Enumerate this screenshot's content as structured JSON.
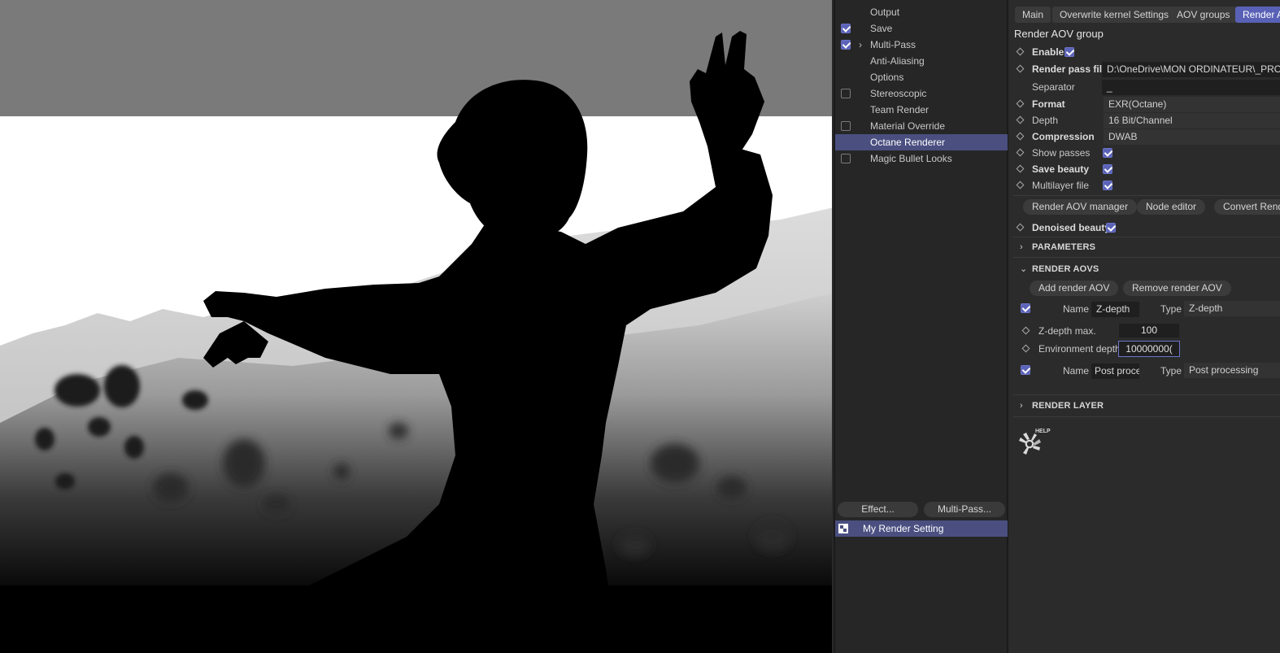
{
  "settings_list": {
    "items": [
      {
        "label": "Output",
        "checkbox": "none",
        "selected": false
      },
      {
        "label": "Save",
        "checkbox": "on",
        "selected": false
      },
      {
        "label": "Multi-Pass",
        "checkbox": "on",
        "expandable": true,
        "selected": false
      },
      {
        "label": "Anti-Aliasing",
        "checkbox": "none",
        "selected": false
      },
      {
        "label": "Options",
        "checkbox": "none",
        "selected": false
      },
      {
        "label": "Stereoscopic",
        "checkbox": "off",
        "selected": false
      },
      {
        "label": "Team Render",
        "checkbox": "none",
        "selected": false
      },
      {
        "label": "Material Override",
        "checkbox": "off",
        "selected": false
      },
      {
        "label": "Octane Renderer",
        "checkbox": "none",
        "selected": true
      },
      {
        "label": "Magic Bullet Looks",
        "checkbox": "off",
        "selected": false
      }
    ],
    "effect_button": "Effect...",
    "multipass_button": "Multi-Pass...",
    "render_setting": "My Render Setting"
  },
  "attr_panel": {
    "tabs": [
      "Main",
      "Overwrite kernel Settings",
      "AOV groups",
      "Render AOV group"
    ],
    "active_tab": 3,
    "title": "Render AOV group",
    "enable_label": "Enable",
    "render_pass_file_label": "Render pass file",
    "render_pass_file_value": "D:\\OneDrive\\MON ORDINATEUR\\_PROJETS",
    "separator_label": "Separator",
    "separator_value": "_",
    "format_label": "Format",
    "format_value": "EXR(Octane)",
    "depth_label": "Depth",
    "depth_value": "16 Bit/Channel",
    "compression_label": "Compression",
    "compression_value": "DWAB",
    "show_passes_label": "Show passes",
    "save_beauty_label": "Save beauty",
    "multilayer_label": "Multilayer file",
    "aov_manager_button": "Render AOV manager",
    "node_editor_button": "Node editor",
    "convert_button": "Convert Render",
    "denoised_beauty_label": "Denoised beauty",
    "parameters_header": "PARAMETERS",
    "render_aovs_header": "RENDER AOVS",
    "add_aov_button": "Add render AOV",
    "remove_aov_button": "Remove render AOV",
    "aov1": {
      "name_label": "Name",
      "name_value": "Z-depth",
      "type_label": "Type",
      "type_value": "Z-depth"
    },
    "zdepth_max_label": "Z-depth max.",
    "zdepth_max_value": "100",
    "env_depth_label": "Environment depth",
    "env_depth_value": "10000000(",
    "aov2": {
      "name_label": "Name",
      "name_value": "Post proce",
      "type_label": "Type",
      "type_value": "Post processing"
    },
    "render_layer_header": "RENDER LAYER",
    "help_label": "HELP"
  },
  "colors": {
    "accent": "#5961b6",
    "selected_row": "#4a4f80",
    "panel_bg": "#2b2b2b",
    "list_bg": "#262626"
  }
}
